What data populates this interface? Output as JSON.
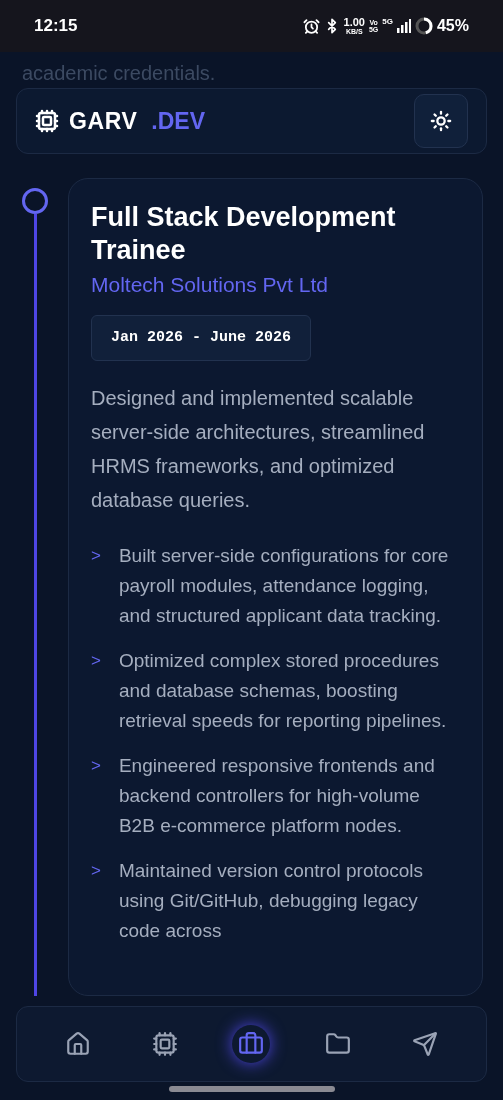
{
  "status_bar": {
    "time": "12:15",
    "speed_value": "1.00",
    "speed_unit": "KB/S",
    "volte": "Vo",
    "volte_net": "5G",
    "network": "5G",
    "battery": "45%"
  },
  "behind_header_text": "academic credentials.",
  "header": {
    "logo_main": "GARV",
    "logo_accent": ".DEV"
  },
  "experience": {
    "title": "Full Stack Development Trainee",
    "company": "Moltech Solutions Pvt Ltd",
    "dates": "Jan 2026 - June 2026",
    "description": "Designed and implemented scalable server-side architectures, streamlined HRMS frameworks, and optimized database queries.",
    "bullets": [
      {
        "marker": ">",
        "text": "Built server-side configurations for core payroll modules, attendance logging, and structured applicant data tracking."
      },
      {
        "marker": ">",
        "text": "Optimized complex stored procedures and database schemas, boosting retrieval speeds for reporting pipelines."
      },
      {
        "marker": ">",
        "text": "Engineered responsive frontends and backend controllers for high-volume B2B e-commerce platform nodes."
      },
      {
        "marker": ">",
        "text": "Maintained version control protocols using Git/GitHub, debugging legacy code across"
      }
    ]
  },
  "nav": [
    {
      "kind": "home",
      "selected": false
    },
    {
      "kind": "chip",
      "selected": false
    },
    {
      "kind": "briefcase",
      "selected": true
    },
    {
      "kind": "folder",
      "selected": false
    },
    {
      "kind": "send",
      "selected": false
    }
  ]
}
